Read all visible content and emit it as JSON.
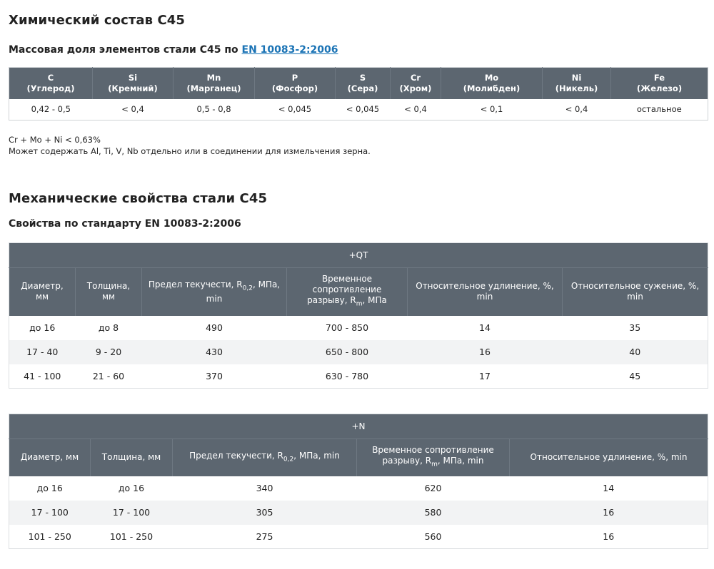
{
  "section1": {
    "title": "Химический состав С45",
    "subtitle_prefix": "Массовая доля элементов стали С45 по ",
    "subtitle_link": "EN 10083-2:2006",
    "table": {
      "headers": [
        {
          "symbol": "C",
          "name": "(Углерод)"
        },
        {
          "symbol": "Si",
          "name": "(Кремний)"
        },
        {
          "symbol": "Mn",
          "name": "(Марганец)"
        },
        {
          "symbol": "P",
          "name": "(Фосфор)"
        },
        {
          "symbol": "S",
          "name": "(Сера)"
        },
        {
          "symbol": "Cr",
          "name": "(Хром)"
        },
        {
          "symbol": "Mo",
          "name": "(Молибден)"
        },
        {
          "symbol": "Ni",
          "name": "(Никель)"
        },
        {
          "symbol": "Fe",
          "name": "(Железо)"
        }
      ],
      "values": [
        "0,42 - 0,5",
        "< 0,4",
        "0,5 - 0,8",
        "< 0,045",
        "< 0,045",
        "< 0,4",
        "< 0,1",
        "< 0,4",
        "остальное"
      ]
    },
    "note1": "Cr + Mo + Ni < 0,63%",
    "note2": "Может содержать Al, Ti, V, Nb отдельно или в соединении для измельчения зерна."
  },
  "section2": {
    "title": "Механические свойства стали С45",
    "subtitle": "Свойства по стандарту EN 10083-2:2006",
    "table_qt": {
      "group": "+QT",
      "headers": {
        "diameter": "Диаметр, мм",
        "thickness": "Толщина, мм",
        "yield_main": "Предел текучести, R",
        "yield_sub": "0,2",
        "yield_tail": ", МПа, min",
        "tensile_main": "Временное сопротивление разрыву, R",
        "tensile_sub": "m",
        "tensile_tail": ", МПа",
        "elongation": "Относительное удлинение, %, min",
        "reduction": "Относительное сужение, %, min"
      },
      "rows": [
        [
          "до 16",
          "до 8",
          "490",
          "700 - 850",
          "14",
          "35"
        ],
        [
          "17 - 40",
          "9 - 20",
          "430",
          "650 - 800",
          "16",
          "40"
        ],
        [
          "41 - 100",
          "21 - 60",
          "370",
          "630 - 780",
          "17",
          "45"
        ]
      ]
    },
    "table_n": {
      "group": "+N",
      "headers": {
        "diameter": "Диаметр, мм",
        "thickness": "Толщина, мм",
        "yield_main": "Предел текучести, R",
        "yield_sub": "0,2",
        "yield_tail": ", МПа, min",
        "tensile_main": "Временное сопротивление разрыву, R",
        "tensile_sub": "m",
        "tensile_tail": ", МПа, min",
        "elongation": "Относительное удлинение, %, min"
      },
      "rows": [
        [
          "до 16",
          "до 16",
          "340",
          "620",
          "14"
        ],
        [
          "17 - 100",
          "17 - 100",
          "305",
          "580",
          "16"
        ],
        [
          "101 - 250",
          "101 - 250",
          "275",
          "560",
          "16"
        ]
      ]
    }
  }
}
